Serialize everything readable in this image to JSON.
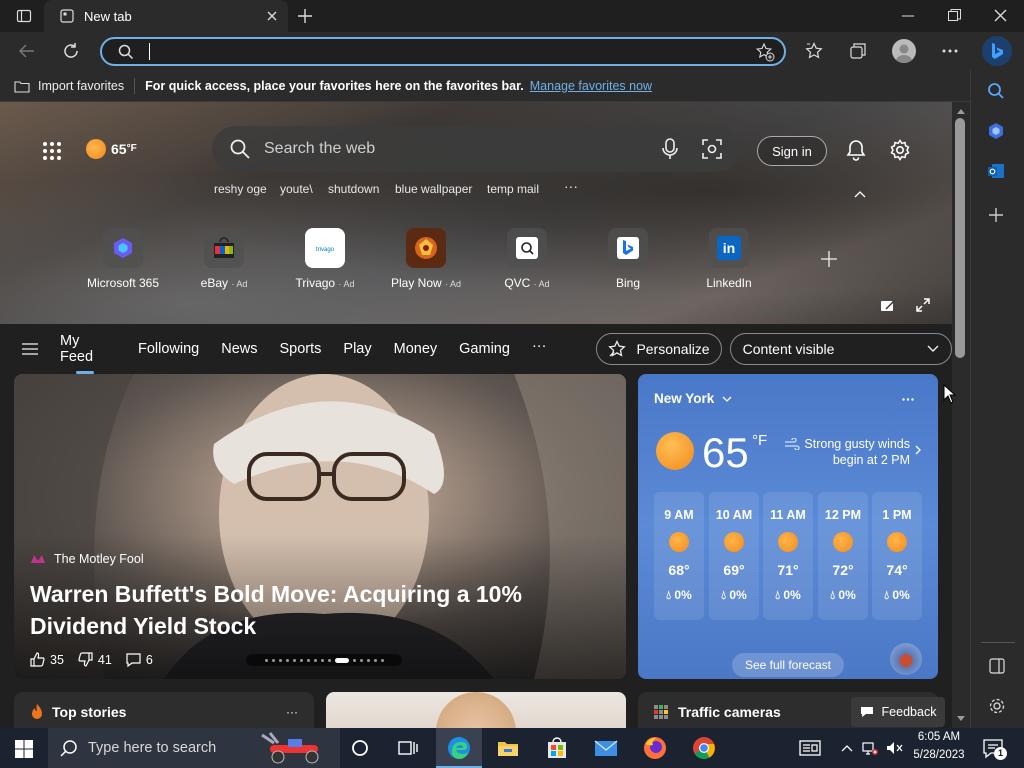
{
  "tab": {
    "title": "New tab"
  },
  "address": {
    "value": "",
    "placeholder": ""
  },
  "favbar": {
    "import_label": "Import favorites",
    "message": "For quick access, place your favorites here on the favorites bar.",
    "manage_link": "Manage favorites now"
  },
  "hero": {
    "temp": "65",
    "temp_unit": "°F",
    "search_placeholder": "Search the web",
    "sign_in": "Sign in",
    "suggestions": [
      "reshy oge",
      "youte\\",
      "shutdown",
      "blue wallpaper",
      "temp mail"
    ],
    "more": "···"
  },
  "quick_links": [
    {
      "name": "Microsoft 365",
      "ad": ""
    },
    {
      "name": "eBay",
      "ad": "· Ad"
    },
    {
      "name": "Trivago",
      "ad": "· Ad"
    },
    {
      "name": "Play Now",
      "ad": "· Ad"
    },
    {
      "name": "QVC",
      "ad": "· Ad"
    },
    {
      "name": "Bing",
      "ad": ""
    },
    {
      "name": "LinkedIn",
      "ad": ""
    }
  ],
  "nav": {
    "items": [
      "My Feed",
      "Following",
      "News",
      "Sports",
      "Play",
      "Money",
      "Gaming"
    ],
    "more": "···",
    "personalize": "Personalize",
    "content_visible": "Content visible"
  },
  "story": {
    "source": "The Motley Fool",
    "headline": "Warren Buffett's Bold Move: Acquiring a 10% Dividend Yield Stock",
    "likes": "35",
    "dislikes": "41",
    "comments": "6"
  },
  "weather": {
    "city": "New York",
    "temp": "65",
    "unit": "°F",
    "alert": "Strong gusty winds begin at 2 PM",
    "hours": [
      {
        "time": "9 AM",
        "temp": "68°",
        "precip": "0%"
      },
      {
        "time": "10 AM",
        "temp": "69°",
        "precip": "0%"
      },
      {
        "time": "11 AM",
        "temp": "71°",
        "precip": "0%"
      },
      {
        "time": "12 PM",
        "temp": "72°",
        "precip": "0%"
      },
      {
        "time": "1 PM",
        "temp": "74°",
        "precip": "0%"
      }
    ],
    "forecast_link": "See full forecast"
  },
  "cards": {
    "top_stories": "Top stories",
    "traffic": "Traffic cameras",
    "feedback": "Feedback",
    "more": "···"
  },
  "taskbar": {
    "search_placeholder": "Type here to search",
    "time": "6:05 AM",
    "date": "5/28/2023",
    "notif_count": "1"
  },
  "colors": {
    "accent": "#6fb0e6",
    "link": "#6fb0e6",
    "weather_bg": "#4a78c8"
  }
}
